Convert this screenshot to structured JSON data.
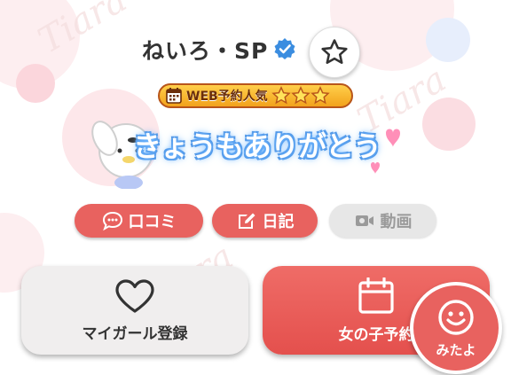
{
  "profile": {
    "name": "ねいろ・SP",
    "rank_label": "WEB予約人気",
    "rank_stars": 3,
    "stamp_text": "きょうもありがとう"
  },
  "tags": {
    "review": "口コミ",
    "diary": "日記",
    "video": "動画"
  },
  "actions": {
    "my_girl": "マイガール登録",
    "reserve": "女の子予約",
    "mitayo": "みたよ"
  },
  "watermark": "Tiara",
  "colors": {
    "accent": "#e8625f",
    "verified": "#3b8de0",
    "badge": "#f2a21c"
  }
}
